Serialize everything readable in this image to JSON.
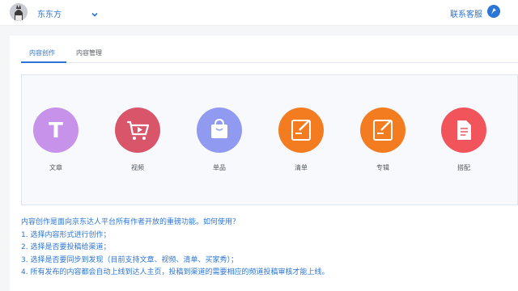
{
  "header": {
    "user_name": "东东方",
    "service_label": "联系客服",
    "avatar": "avatar-photo",
    "menu_icon": "chevron-down-icon",
    "logo_icon": "brand-logo-icon"
  },
  "tabs": [
    {
      "label": "内容创作",
      "active": true
    },
    {
      "label": "内容管理",
      "active": false
    }
  ],
  "content_types": [
    {
      "label": "文章",
      "icon": "text-t-icon",
      "color": "#c792ea"
    },
    {
      "label": "视频",
      "icon": "video-cart-icon",
      "color": "#d9556a"
    },
    {
      "label": "单品",
      "icon": "shopping-bag-icon",
      "color": "#8f9af0"
    },
    {
      "label": "清单",
      "icon": "edit-note-icon",
      "color": "#f47c20"
    },
    {
      "label": "专辑",
      "icon": "edit-note-icon",
      "color": "#f47c20"
    },
    {
      "label": "搭配",
      "icon": "document-icon",
      "color": "#f2545b"
    }
  ],
  "help": {
    "intro": "内容创作是面向京东达人平台所有作者开放的重磅功能。如何使用？",
    "steps": [
      "1. 选择内容形式进行创作；",
      "2. 选择是否要投稿给渠道；",
      "3. 选择是否要同步到发现（目前支持文章、视频、清单、买家秀）；",
      "4. 所有发布的内容都会自动上线到达人主页，投稿到渠道的需要相应的频道投稿审核才能上线。"
    ]
  },
  "colors": {
    "accent": "#2b75d6"
  }
}
